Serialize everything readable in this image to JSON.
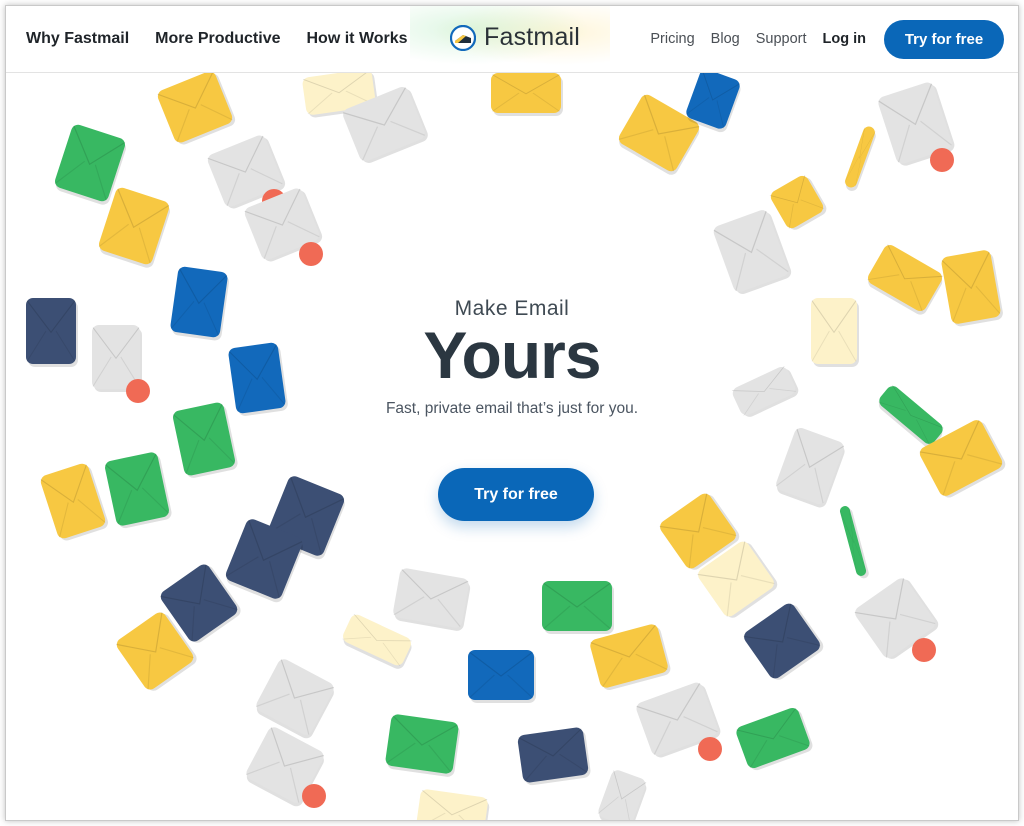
{
  "nav": {
    "left_items": [
      "Why Fastmail",
      "More Productive",
      "How it Works"
    ],
    "right_items": [
      "Pricing",
      "Blog",
      "Support"
    ],
    "login": "Log in",
    "cta": "Try for free"
  },
  "logo": {
    "text": "Fastmail"
  },
  "hero": {
    "kicker": "Make Email",
    "headline": "Yours",
    "subtitle": "Fast, private email that’s just for you.",
    "cta": "Try for free"
  },
  "colors": {
    "brand_blue": "#0a67b8",
    "envelope_yellow": "#f7c842",
    "envelope_green": "#38b862",
    "envelope_navy": "#3c4f74",
    "envelope_blue": "#1269bb",
    "envelope_gray": "#e3e3e3",
    "notification_dot": "#f06a55"
  }
}
